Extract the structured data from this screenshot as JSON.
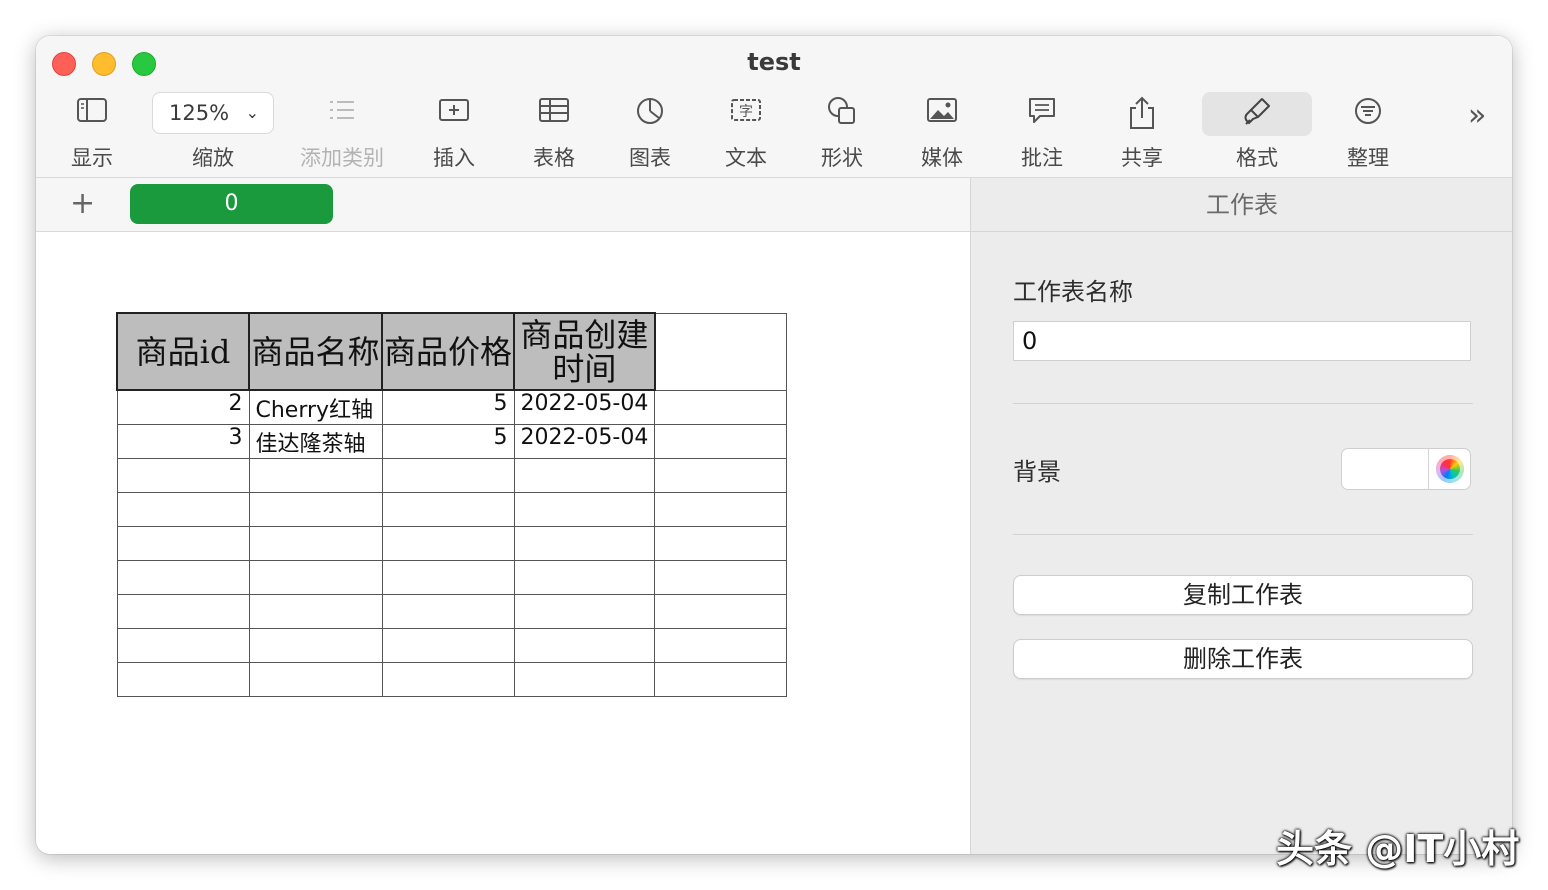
{
  "window": {
    "title": "test"
  },
  "toolbar": {
    "view_label": "显示",
    "zoom_value": "125%",
    "zoom_label": "缩放",
    "add_category_label": "添加类别",
    "insert_label": "插入",
    "table_label": "表格",
    "chart_label": "图表",
    "text_label": "文本",
    "shape_label": "形状",
    "media_label": "媒体",
    "comment_label": "批注",
    "share_label": "共享",
    "format_label": "格式",
    "organize_label": "整理",
    "more_glyph": "»"
  },
  "tabbar": {
    "add_glyph": "+",
    "sheet_name": "0"
  },
  "table": {
    "headers": [
      "商品id",
      "商品名称",
      "商品价格",
      "商品创建时间"
    ],
    "rows": [
      {
        "id": "2",
        "name": "Cherry红轴",
        "price": "5",
        "created": "2022-05-04"
      },
      {
        "id": "3",
        "name": "佳达隆茶轴",
        "price": "5",
        "created": "2022-05-04"
      }
    ]
  },
  "sidebar": {
    "header": "工作表",
    "sheet_name_label": "工作表名称",
    "sheet_name_value": "0",
    "background_label": "背景",
    "duplicate_button": "复制工作表",
    "delete_button": "删除工作表"
  },
  "watermark": "头条 @IT小村"
}
